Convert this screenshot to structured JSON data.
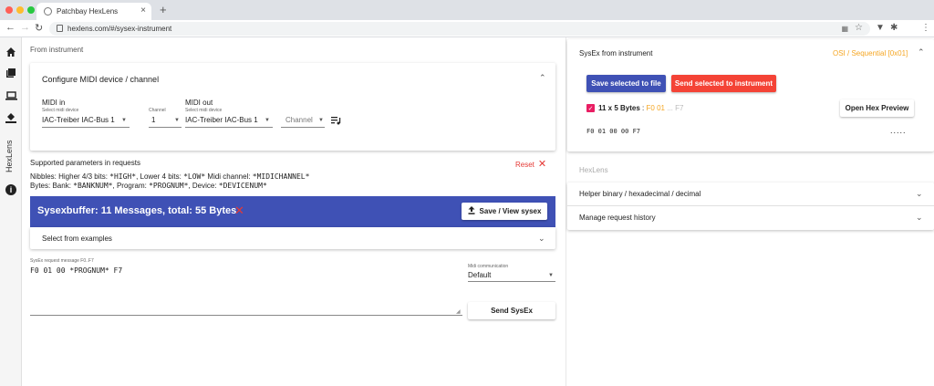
{
  "browser": {
    "tab_title": "Patchbay HexLens",
    "url": "hexlens.com/#/sysex-instrument"
  },
  "rail": {
    "vertical_label": "HexLens"
  },
  "left": {
    "section_label": "From instrument",
    "configure": {
      "title": "Configure MIDI device / channel",
      "midi_in_label": "MIDI in",
      "midi_out_label": "MIDI out",
      "select_midi_device": "Select midi device",
      "channel_label": "Channel",
      "in_device": "IAC-Treiber IAC-Bus 1",
      "in_channel": "1",
      "out_device": "IAC-Treiber IAC-Bus 1",
      "out_channel_placeholder": "Channel"
    },
    "params": {
      "title": "Supported parameters in requests",
      "reset": "Reset",
      "line1_prefix": "Nibbles: Higher 4/3 bits: ",
      "line1_high": "*HIGH*",
      "line1_mid": ", Lower 4 bits: ",
      "line1_low": "*LOW*",
      "line1_mid2": " Midi channel: ",
      "line1_ch": "*MIDICHANNEL*",
      "line2_prefix": "Bytes: Bank: ",
      "line2_bank": "*BANKNUM*",
      "line2_mid": ", Program: ",
      "line2_prog": "*PROGNUM*",
      "line2_mid2": ", Device: ",
      "line2_dev": "*DEVICENUM*"
    },
    "sysexbuffer": {
      "title": "Sysexbuffer: 11 Messages, total: 55 Bytes",
      "save_button": "Save / View sysex"
    },
    "examples": {
      "title": "Select from examples"
    },
    "request": {
      "field_label": "SysEx request message F0..F7",
      "value": "F0 01 00 *PROGNUM* F7",
      "midi_comm_label": "Midi communication",
      "midi_comm_value": "Default",
      "send_button": "Send SysEx"
    }
  },
  "right": {
    "sysex_panel": {
      "title": "SysEx from instrument",
      "mode": "OSI / Sequential [0x01]",
      "save_selected": "Save selected to file",
      "send_selected": "Send selected to instrument",
      "entry_count": "11 x 5 Bytes",
      "entry_sep": " : ",
      "entry_f0": "F0",
      "entry_01": "01",
      "entry_dots": "...",
      "entry_f7": "F7",
      "open_hex": "Open Hex Preview",
      "hex_line": "F0  01  00  00  F7",
      "more_dots": "....."
    },
    "hexlens": {
      "label": "HexLens",
      "helper": "Helper binary / hexadecimal / decimal",
      "history": "Manage request history"
    }
  },
  "colors": {
    "primary": "#3f51b5",
    "danger": "#f44336",
    "accent": "#e91e63",
    "highlight": "#f5a623"
  }
}
